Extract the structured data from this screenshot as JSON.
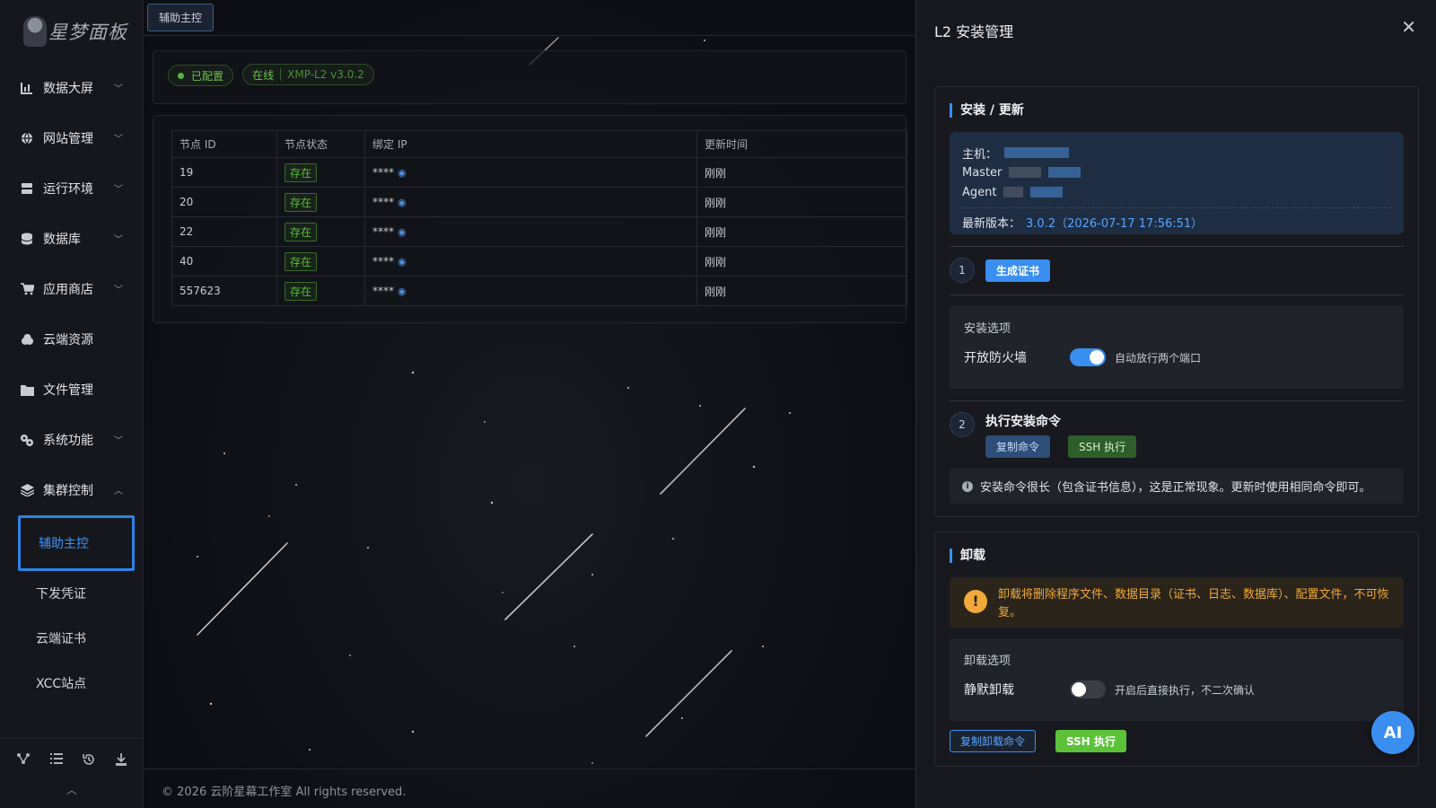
{
  "sidebar": {
    "logo_text": "星梦面板",
    "items": [
      {
        "label": "数据大屏",
        "icon": "chart-icon",
        "chevron": "down"
      },
      {
        "label": "网站管理",
        "icon": "globe-icon",
        "chevron": "down"
      },
      {
        "label": "运行环境",
        "icon": "server-icon",
        "chevron": "down"
      },
      {
        "label": "数据库",
        "icon": "database-icon",
        "chevron": "down"
      },
      {
        "label": "应用商店",
        "icon": "cart-icon",
        "chevron": "down"
      },
      {
        "label": "云端资源",
        "icon": "cloud-icon"
      },
      {
        "label": "文件管理",
        "icon": "folder-icon"
      },
      {
        "label": "系统功能",
        "icon": "gears-icon",
        "chevron": "down"
      },
      {
        "label": "集群控制",
        "icon": "layers-icon",
        "chevron": "up"
      }
    ],
    "subitems": [
      {
        "label": "辅助主控",
        "active": true
      },
      {
        "label": "下发凭证"
      },
      {
        "label": "云端证书"
      },
      {
        "label": "XCC站点"
      }
    ],
    "footer_icons": [
      "network-icon",
      "list-icon",
      "history-icon",
      "download-icon"
    ]
  },
  "main": {
    "tab_label": "辅助主控",
    "status": {
      "configured": "已配置",
      "online": "在线",
      "version": "XMP-L2 v3.0.2"
    },
    "table": {
      "headers": [
        "节点 ID",
        "节点状态",
        "绑定 IP",
        "更新时间"
      ],
      "rows": [
        {
          "id": "19",
          "status": "存在",
          "ip": "****",
          "time": "刚刚"
        },
        {
          "id": "20",
          "status": "存在",
          "ip": "****",
          "time": "刚刚"
        },
        {
          "id": "22",
          "status": "存在",
          "ip": "****",
          "time": "刚刚"
        },
        {
          "id": "40",
          "status": "存在",
          "ip": "****",
          "time": "刚刚"
        },
        {
          "id": "557623",
          "status": "存在",
          "ip": "****",
          "time": "刚刚"
        }
      ]
    },
    "copyright": "© 2026 云阶星幕工作室 All rights reserved."
  },
  "drawer": {
    "title": "L2 安装管理",
    "close_icon": "close-icon",
    "install": {
      "title": "安装 / 更新",
      "host_label": "主机：",
      "master_label": "Master",
      "agent_label": "Agent",
      "latest_label": "最新版本：",
      "latest_value": "3.0.2（2026-07-17 17:56:51）",
      "step1_num": "1",
      "step1_button": "生成证书",
      "options_title": "安装选项",
      "firewall_label": "开放防火墙",
      "firewall_on": true,
      "firewall_hint": "自动放行两个端口",
      "step2_num": "2",
      "step2_title": "执行安装命令",
      "copy_cmd": "复制命令",
      "ssh_exec": "SSH 执行",
      "note": "安装命令很长（包含证书信息），这是正常现象。更新时使用相同命令即可。"
    },
    "uninstall": {
      "title": "卸载",
      "warning": "卸载将删除程序文件、数据目录（证书、日志、数据库）、配置文件，不可恢复。",
      "options_title": "卸载选项",
      "silent_label": "静默卸载",
      "silent_on": false,
      "silent_hint": "开启后直接执行，不二次确认",
      "copy_uninstall": "复制卸载命令",
      "ssh_exec": "SSH 执行"
    }
  },
  "ai_button": "AI",
  "colors": {
    "accent": "#3a8ef0",
    "success": "#5cc23a",
    "warning": "#f0a93a"
  }
}
